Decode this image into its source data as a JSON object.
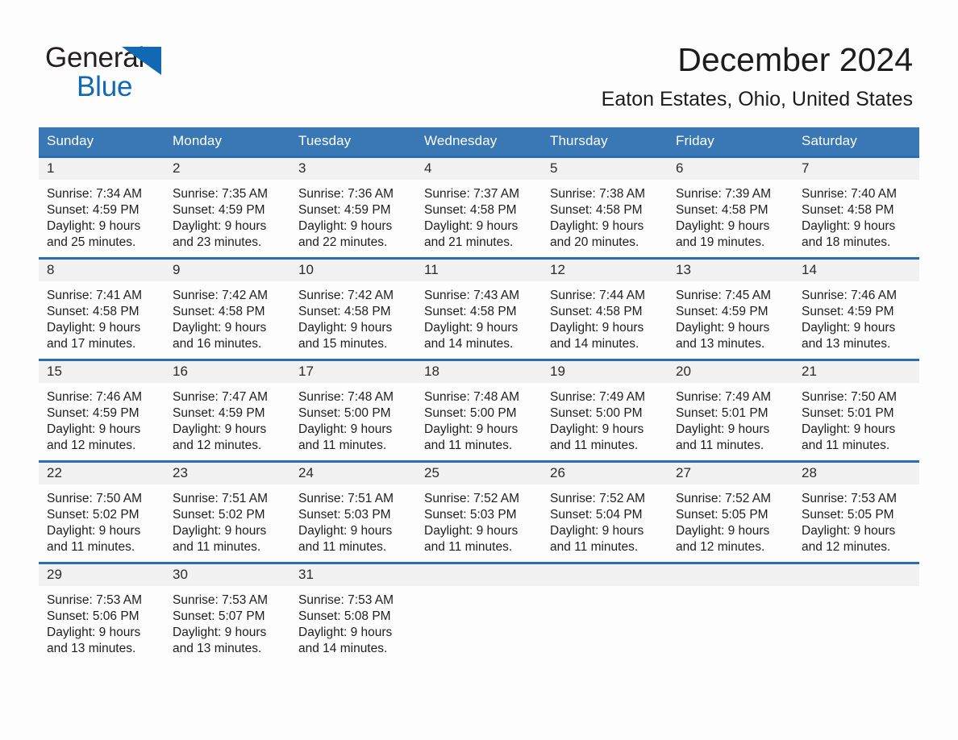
{
  "brand": {
    "word_general": "General",
    "word_blue": "Blue",
    "triangle_color": "#1168b3",
    "general_color": "#231f20",
    "blue_color": "#1168b3"
  },
  "header": {
    "month_title": "December 2024",
    "location": "Eaton Estates, Ohio, United States"
  },
  "theme": {
    "header_blue": "#3a77b5",
    "row_divider_blue": "#2a6db3",
    "daynum_band": "#f1f1f1",
    "page_background": "#fdfdfd",
    "text_color": "#1e1e1e"
  },
  "weekday_headers": [
    "Sunday",
    "Monday",
    "Tuesday",
    "Wednesday",
    "Thursday",
    "Friday",
    "Saturday"
  ],
  "weeks": [
    [
      {
        "day": "1",
        "sunrise": "Sunrise: 7:34 AM",
        "sunset": "Sunset: 4:59 PM",
        "daylight_line1": "Daylight: 9 hours",
        "daylight_line2": "and 25 minutes."
      },
      {
        "day": "2",
        "sunrise": "Sunrise: 7:35 AM",
        "sunset": "Sunset: 4:59 PM",
        "daylight_line1": "Daylight: 9 hours",
        "daylight_line2": "and 23 minutes."
      },
      {
        "day": "3",
        "sunrise": "Sunrise: 7:36 AM",
        "sunset": "Sunset: 4:59 PM",
        "daylight_line1": "Daylight: 9 hours",
        "daylight_line2": "and 22 minutes."
      },
      {
        "day": "4",
        "sunrise": "Sunrise: 7:37 AM",
        "sunset": "Sunset: 4:58 PM",
        "daylight_line1": "Daylight: 9 hours",
        "daylight_line2": "and 21 minutes."
      },
      {
        "day": "5",
        "sunrise": "Sunrise: 7:38 AM",
        "sunset": "Sunset: 4:58 PM",
        "daylight_line1": "Daylight: 9 hours",
        "daylight_line2": "and 20 minutes."
      },
      {
        "day": "6",
        "sunrise": "Sunrise: 7:39 AM",
        "sunset": "Sunset: 4:58 PM",
        "daylight_line1": "Daylight: 9 hours",
        "daylight_line2": "and 19 minutes."
      },
      {
        "day": "7",
        "sunrise": "Sunrise: 7:40 AM",
        "sunset": "Sunset: 4:58 PM",
        "daylight_line1": "Daylight: 9 hours",
        "daylight_line2": "and 18 minutes."
      }
    ],
    [
      {
        "day": "8",
        "sunrise": "Sunrise: 7:41 AM",
        "sunset": "Sunset: 4:58 PM",
        "daylight_line1": "Daylight: 9 hours",
        "daylight_line2": "and 17 minutes."
      },
      {
        "day": "9",
        "sunrise": "Sunrise: 7:42 AM",
        "sunset": "Sunset: 4:58 PM",
        "daylight_line1": "Daylight: 9 hours",
        "daylight_line2": "and 16 minutes."
      },
      {
        "day": "10",
        "sunrise": "Sunrise: 7:42 AM",
        "sunset": "Sunset: 4:58 PM",
        "daylight_line1": "Daylight: 9 hours",
        "daylight_line2": "and 15 minutes."
      },
      {
        "day": "11",
        "sunrise": "Sunrise: 7:43 AM",
        "sunset": "Sunset: 4:58 PM",
        "daylight_line1": "Daylight: 9 hours",
        "daylight_line2": "and 14 minutes."
      },
      {
        "day": "12",
        "sunrise": "Sunrise: 7:44 AM",
        "sunset": "Sunset: 4:58 PM",
        "daylight_line1": "Daylight: 9 hours",
        "daylight_line2": "and 14 minutes."
      },
      {
        "day": "13",
        "sunrise": "Sunrise: 7:45 AM",
        "sunset": "Sunset: 4:59 PM",
        "daylight_line1": "Daylight: 9 hours",
        "daylight_line2": "and 13 minutes."
      },
      {
        "day": "14",
        "sunrise": "Sunrise: 7:46 AM",
        "sunset": "Sunset: 4:59 PM",
        "daylight_line1": "Daylight: 9 hours",
        "daylight_line2": "and 13 minutes."
      }
    ],
    [
      {
        "day": "15",
        "sunrise": "Sunrise: 7:46 AM",
        "sunset": "Sunset: 4:59 PM",
        "daylight_line1": "Daylight: 9 hours",
        "daylight_line2": "and 12 minutes."
      },
      {
        "day": "16",
        "sunrise": "Sunrise: 7:47 AM",
        "sunset": "Sunset: 4:59 PM",
        "daylight_line1": "Daylight: 9 hours",
        "daylight_line2": "and 12 minutes."
      },
      {
        "day": "17",
        "sunrise": "Sunrise: 7:48 AM",
        "sunset": "Sunset: 5:00 PM",
        "daylight_line1": "Daylight: 9 hours",
        "daylight_line2": "and 11 minutes."
      },
      {
        "day": "18",
        "sunrise": "Sunrise: 7:48 AM",
        "sunset": "Sunset: 5:00 PM",
        "daylight_line1": "Daylight: 9 hours",
        "daylight_line2": "and 11 minutes."
      },
      {
        "day": "19",
        "sunrise": "Sunrise: 7:49 AM",
        "sunset": "Sunset: 5:00 PM",
        "daylight_line1": "Daylight: 9 hours",
        "daylight_line2": "and 11 minutes."
      },
      {
        "day": "20",
        "sunrise": "Sunrise: 7:49 AM",
        "sunset": "Sunset: 5:01 PM",
        "daylight_line1": "Daylight: 9 hours",
        "daylight_line2": "and 11 minutes."
      },
      {
        "day": "21",
        "sunrise": "Sunrise: 7:50 AM",
        "sunset": "Sunset: 5:01 PM",
        "daylight_line1": "Daylight: 9 hours",
        "daylight_line2": "and 11 minutes."
      }
    ],
    [
      {
        "day": "22",
        "sunrise": "Sunrise: 7:50 AM",
        "sunset": "Sunset: 5:02 PM",
        "daylight_line1": "Daylight: 9 hours",
        "daylight_line2": "and 11 minutes."
      },
      {
        "day": "23",
        "sunrise": "Sunrise: 7:51 AM",
        "sunset": "Sunset: 5:02 PM",
        "daylight_line1": "Daylight: 9 hours",
        "daylight_line2": "and 11 minutes."
      },
      {
        "day": "24",
        "sunrise": "Sunrise: 7:51 AM",
        "sunset": "Sunset: 5:03 PM",
        "daylight_line1": "Daylight: 9 hours",
        "daylight_line2": "and 11 minutes."
      },
      {
        "day": "25",
        "sunrise": "Sunrise: 7:52 AM",
        "sunset": "Sunset: 5:03 PM",
        "daylight_line1": "Daylight: 9 hours",
        "daylight_line2": "and 11 minutes."
      },
      {
        "day": "26",
        "sunrise": "Sunrise: 7:52 AM",
        "sunset": "Sunset: 5:04 PM",
        "daylight_line1": "Daylight: 9 hours",
        "daylight_line2": "and 11 minutes."
      },
      {
        "day": "27",
        "sunrise": "Sunrise: 7:52 AM",
        "sunset": "Sunset: 5:05 PM",
        "daylight_line1": "Daylight: 9 hours",
        "daylight_line2": "and 12 minutes."
      },
      {
        "day": "28",
        "sunrise": "Sunrise: 7:53 AM",
        "sunset": "Sunset: 5:05 PM",
        "daylight_line1": "Daylight: 9 hours",
        "daylight_line2": "and 12 minutes."
      }
    ],
    [
      {
        "day": "29",
        "sunrise": "Sunrise: 7:53 AM",
        "sunset": "Sunset: 5:06 PM",
        "daylight_line1": "Daylight: 9 hours",
        "daylight_line2": "and 13 minutes."
      },
      {
        "day": "30",
        "sunrise": "Sunrise: 7:53 AM",
        "sunset": "Sunset: 5:07 PM",
        "daylight_line1": "Daylight: 9 hours",
        "daylight_line2": "and 13 minutes."
      },
      {
        "day": "31",
        "sunrise": "Sunrise: 7:53 AM",
        "sunset": "Sunset: 5:08 PM",
        "daylight_line1": "Daylight: 9 hours",
        "daylight_line2": "and 14 minutes."
      },
      {
        "day": "",
        "sunrise": "",
        "sunset": "",
        "daylight_line1": "",
        "daylight_line2": ""
      },
      {
        "day": "",
        "sunrise": "",
        "sunset": "",
        "daylight_line1": "",
        "daylight_line2": ""
      },
      {
        "day": "",
        "sunrise": "",
        "sunset": "",
        "daylight_line1": "",
        "daylight_line2": ""
      },
      {
        "day": "",
        "sunrise": "",
        "sunset": "",
        "daylight_line1": "",
        "daylight_line2": ""
      }
    ]
  ]
}
